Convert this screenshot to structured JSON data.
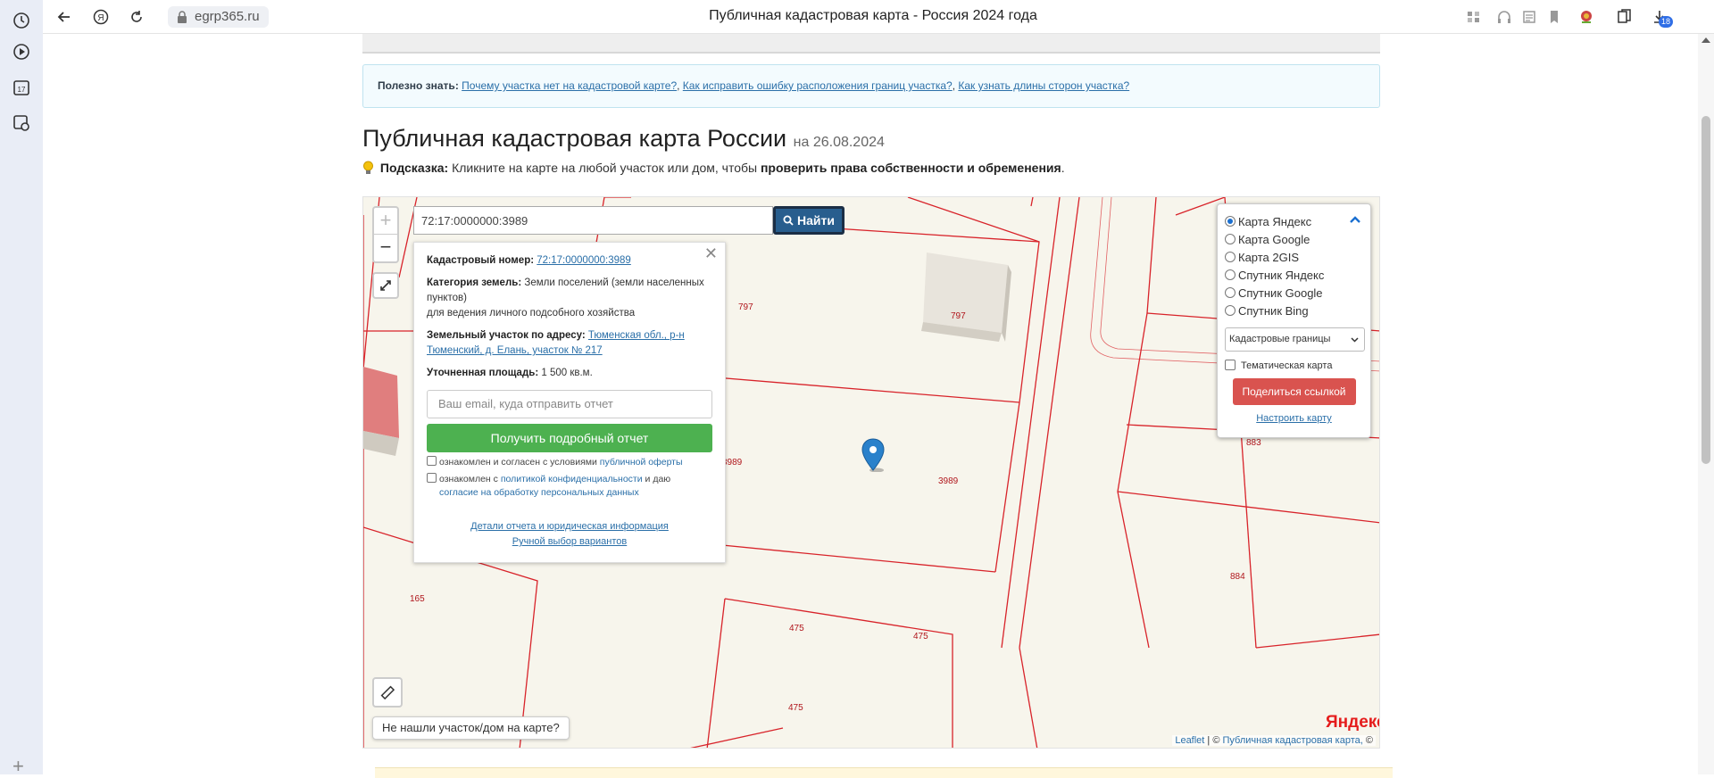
{
  "browser": {
    "url": "egrp365.ru",
    "title": "Публичная кадастровая карта - Россия 2024 года",
    "downloads_badge": "18"
  },
  "page": {
    "info": {
      "label": "Полезно знать:",
      "links": [
        "Почему участка нет на кадастровой карте?",
        "Как исправить ошибку расположения границ участка?",
        "Как узнать длины сторон участка?"
      ]
    },
    "heading": "Публичная кадастровая карта России",
    "heading_date": "на 26.08.2024",
    "hint": {
      "label": "Подсказка:",
      "text": "Кликните на карте на любой участок или дом, чтобы",
      "bold": "проверить права собственности и обременения",
      "end": "."
    }
  },
  "map": {
    "search_value": "72:17:0000000:3989",
    "find_label": "Найти",
    "zoom_in": "+",
    "zoom_out": "−",
    "parcel_labels": [
      "797",
      "797",
      "3989",
      "3989",
      "165",
      "475",
      "475",
      "475",
      "884",
      "883"
    ],
    "popup": {
      "cad_label": "Кадастровый номер:",
      "cad_value": "72:17:0000000:3989",
      "cat_label": "Категория земель:",
      "cat_value": "Земли поселений (земли населенных пунктов)",
      "cat_use": "для ведения личного подсобного хозяйства",
      "addr_label": "Земельный участок по адресу:",
      "addr_value": "Тюменская обл., р-н Тюменский, д. Елань, участок № 217",
      "area_label": "Уточненная площадь:",
      "area_value": "1 500 кв.м.",
      "email_placeholder": "Ваш email, куда отправить отчет",
      "report_button": "Получить подробный отчет",
      "agree1_text": "ознакомлен и согласен с условиями",
      "agree1_link": "публичной оферты",
      "agree2_text": "ознакомлен с",
      "agree2_link": "политикой конфиденциальности",
      "agree2_mid": "и даю",
      "agree2_link2": "согласие на обработку персональных данных",
      "details_link": "Детали отчета и юридическая информация",
      "manual_link": "Ручной выбор вариантов"
    },
    "layers": {
      "options": [
        "Карта Яндекс",
        "Карта Google",
        "Карта 2GIS",
        "Спутник Яндекс",
        "Спутник Google",
        "Спутник Bing"
      ],
      "selected": "Карта Яндекс",
      "overlay_select": "Кадастровые границы",
      "thematic_label": "Тематическая карта",
      "share_button": "Поделиться ссылкой",
      "setup_link": "Настроить карту"
    },
    "notfound_label": "Не нашли участок/дом на карте?",
    "yandex_logo": "Яндекс",
    "attribution": {
      "leaflet": "Leaflet",
      "sep": "|",
      "pkk": "Публичная кадастровая карта,",
      "copy": "©"
    },
    "colors": {
      "parcel_line": "#d8232a",
      "map_bg": "#f7f5ec",
      "find_button": "#285e8e",
      "report_button": "#4db150",
      "share_button": "#d9534f",
      "marker": "#2a81cb"
    }
  }
}
